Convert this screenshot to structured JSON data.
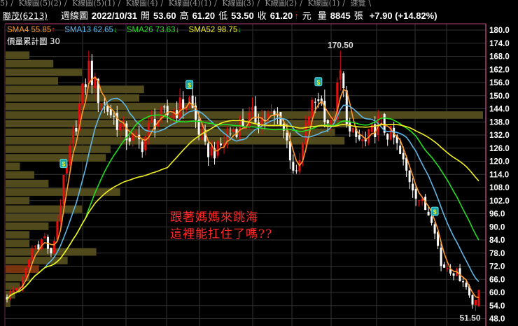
{
  "tabs": [
    "5)",
    "K線圖(5)(2)",
    "K線圖(5)(1)",
    "K線圖(4)",
    "K線圖(4)(1)",
    "K線圖(3)",
    "K線圖(2)",
    "K線圖(1)",
    "速覽"
  ],
  "header": {
    "stock": "聯茂(6213)",
    "period": "週線圖",
    "date": "2022/10/31",
    "open_label": "開",
    "open": "53.60",
    "high_label": "高",
    "high": "61.20",
    "low_label": "低",
    "low": "53.50",
    "close_label": "收",
    "close": "61.20",
    "close_arrow": "↑",
    "currency": "元",
    "volume_label": "量",
    "volume": "8845",
    "volume_unit": "張",
    "change": "+7.90 (+14.82%)"
  },
  "legend": {
    "sma4": {
      "label": "SMA4 55.85",
      "arrow": "↑",
      "color": "#ff9a2e",
      "arrow_color": "#ff2020"
    },
    "sma13": {
      "label": "SMA13 62.65",
      "arrow": "↓",
      "color": "#5fb7e6",
      "arrow_color": "#20e020"
    },
    "sma26": {
      "label": "SMA26 73.63",
      "arrow": "↓",
      "color": "#22dd22",
      "arrow_color": "#20e020"
    },
    "sma52": {
      "label": "SMA52 98.75",
      "arrow": "↓",
      "color": "#f2f020",
      "arrow_color": "#20e020"
    },
    "volume_profile": "價量累計圖 30"
  },
  "annotation": {
    "line1": "跟著媽媽來跳海",
    "line2": "這裡能扛住了嗎??"
  },
  "chart_data": {
    "type": "candlestick",
    "title": "聯茂(6213) 週線圖",
    "ylim": [
      48,
      180
    ],
    "yticks": [
      "180.0",
      "174.0",
      "168.0",
      "162.0",
      "156.0",
      "150.0",
      "144.0",
      "138.0",
      "132.0",
      "126.0",
      "120.0",
      "114.0",
      "108.0",
      "102.0",
      "96.0",
      "90.0",
      "84.0",
      "78.0",
      "72.0",
      "66.0",
      "60.0",
      "54.0",
      "48.0"
    ],
    "ytick_values": [
      180,
      174,
      168,
      162,
      156,
      150,
      144,
      138,
      132,
      126,
      120,
      114,
      108,
      102,
      96,
      90,
      84,
      78,
      72,
      66,
      60,
      54,
      48
    ],
    "candle_count": 151,
    "close_path": [
      [
        0,
        58
      ],
      [
        5,
        65
      ],
      [
        8,
        80
      ],
      [
        12,
        85
      ],
      [
        14,
        76
      ],
      [
        18,
        110
      ],
      [
        23,
        145
      ],
      [
        26,
        163
      ],
      [
        29,
        150
      ],
      [
        34,
        140
      ],
      [
        38,
        132
      ],
      [
        43,
        128
      ],
      [
        46,
        138
      ],
      [
        52,
        142
      ],
      [
        58,
        148
      ],
      [
        63,
        125
      ],
      [
        67,
        125
      ],
      [
        72,
        135
      ],
      [
        78,
        140
      ],
      [
        87,
        140
      ],
      [
        92,
        112
      ],
      [
        96,
        142
      ],
      [
        99,
        150
      ],
      [
        103,
        135
      ],
      [
        106,
        160
      ],
      [
        109,
        132
      ],
      [
        114,
        128
      ],
      [
        118,
        138
      ],
      [
        123,
        130
      ],
      [
        127,
        115
      ],
      [
        132,
        100
      ],
      [
        135,
        95
      ],
      [
        136,
        90
      ],
      [
        138,
        72
      ],
      [
        140,
        72
      ],
      [
        145,
        66
      ],
      [
        148,
        55
      ],
      [
        150,
        61.2
      ]
    ],
    "last_candle": {
      "open": 53.6,
      "high": 61.2,
      "low": 53.5,
      "close": 61.2
    },
    "max_label": {
      "text": "170.50",
      "value": 170.5,
      "index": 106
    },
    "min_label": {
      "text": "51.50",
      "value": 51.5,
      "index": 149
    },
    "signal_indices": [
      18,
      58,
      99,
      136
    ],
    "volume_profile": {
      "bins": 30,
      "price_top": 170.4,
      "price_bottom": 53.0,
      "current_bin": 25,
      "relative_volume": [
        5,
        10,
        16,
        11,
        29,
        28,
        40,
        100,
        72,
        69,
        71,
        22,
        21,
        3,
        6,
        9,
        24,
        5,
        16,
        12,
        9,
        5,
        5,
        19,
        13,
        7,
        5,
        3,
        2,
        1
      ]
    },
    "sma_periods": [
      4,
      13,
      26,
      52
    ],
    "colors": {
      "up": "#e41010",
      "down": "#ffffff",
      "volume": "#514a1c",
      "volume_current": "#7a3510",
      "grid": "#333333",
      "border": "#b0407a"
    }
  }
}
